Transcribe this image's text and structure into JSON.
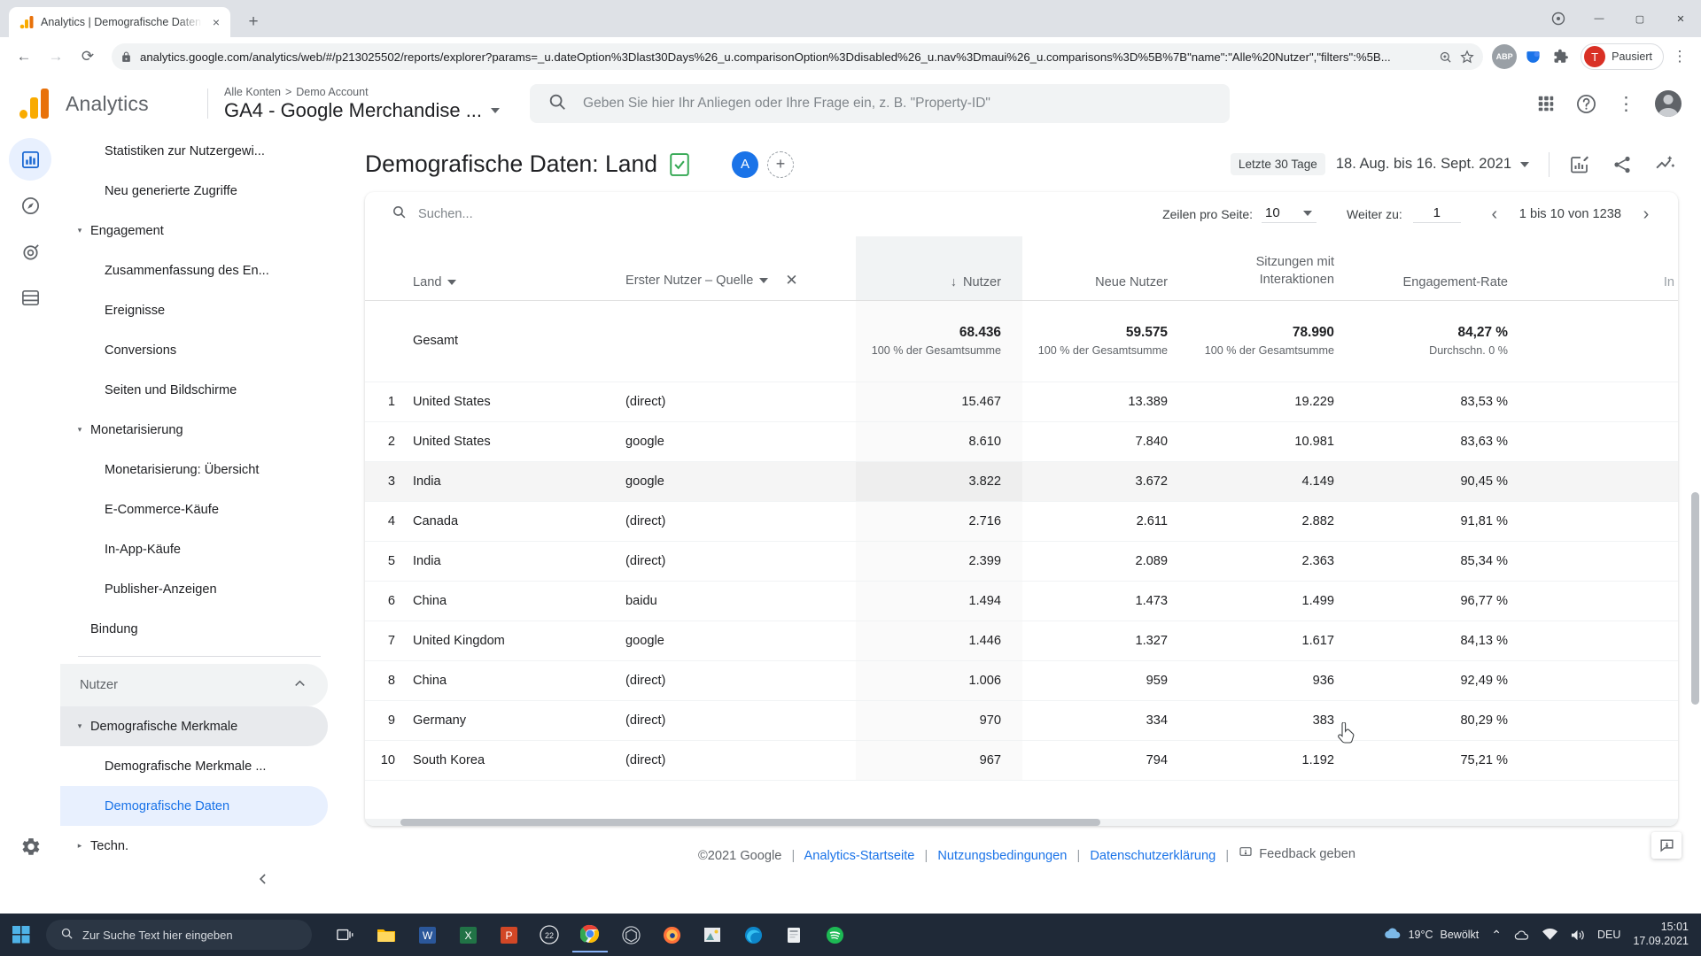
{
  "browser": {
    "tab": {
      "title": "Analytics | Demografische Daten",
      "favicon": "analytics-logo-icon",
      "close": "×"
    },
    "new_tab_label": "+",
    "window_controls": {
      "minimize": "—",
      "maximize": "▢",
      "close": "✕"
    },
    "nav": {
      "back": "←",
      "forward": "→",
      "reload": "⟳"
    },
    "omnibox": {
      "lock": "lock-icon",
      "url": "analytics.google.com/analytics/web/#/p213025502/reports/explorer?params=_u.dateOption%3Dlast30Days%26_u.comparisonOption%3Ddisabled%26_u.nav%3Dmaui%26_u.comparisons%3D%5B%7B\"name\":\"Alle%20Nutzer\",\"filters\":%5B...",
      "zoom_icon": "zoom-search-icon",
      "star_icon": "bookmark-star-icon"
    },
    "extensions": [
      {
        "name": "abp-extension-icon",
        "label": "ABP"
      },
      {
        "name": "pocket-extension-icon",
        "label": "◉"
      },
      {
        "name": "puzzle-extensions-icon",
        "label": "🧩"
      }
    ],
    "profile": {
      "initial": "T",
      "label": "Pausiert"
    },
    "menu_icon": "kebab-menu-icon"
  },
  "ga_header": {
    "wordmark": "Analytics",
    "breadcrumb": [
      "Alle Konten",
      "Demo Account"
    ],
    "breadcrumb_separator": ">",
    "property_name": "GA4 - Google Merchandise ...",
    "search_placeholder": "Geben Sie hier Ihr Anliegen oder Ihre Frage ein, z. B. \"Property-ID\"",
    "search_value": "",
    "icons": {
      "apps": "apps-grid-icon",
      "help": "help-circle-icon",
      "more": "kebab-menu-icon",
      "avatar": "user-avatar"
    }
  },
  "rail": {
    "items": [
      {
        "name": "reports-bar-chart-icon",
        "active": true
      },
      {
        "name": "explore-compass-icon",
        "active": false
      },
      {
        "name": "advertising-target-icon",
        "active": false
      },
      {
        "name": "configure-table-icon",
        "active": false
      }
    ],
    "settings_icon": "gear-icon"
  },
  "sidebar": {
    "items": [
      {
        "label": "Statistiken zur Nutzergewi...",
        "level": "child",
        "state": "normal",
        "twisty": ""
      },
      {
        "label": "Neu generierte Zugriffe",
        "level": "child",
        "state": "normal",
        "twisty": ""
      },
      {
        "label": "Engagement",
        "level": "group",
        "state": "normal",
        "twisty": "▾"
      },
      {
        "label": "Zusammenfassung des En...",
        "level": "child",
        "state": "normal",
        "twisty": ""
      },
      {
        "label": "Ereignisse",
        "level": "child",
        "state": "normal",
        "twisty": ""
      },
      {
        "label": "Conversions",
        "level": "child",
        "state": "normal",
        "twisty": ""
      },
      {
        "label": "Seiten und Bildschirme",
        "level": "child",
        "state": "normal",
        "twisty": ""
      },
      {
        "label": "Monetarisierung",
        "level": "group",
        "state": "normal",
        "twisty": "▾"
      },
      {
        "label": "Monetarisierung: Übersicht",
        "level": "child",
        "state": "normal",
        "twisty": ""
      },
      {
        "label": "E-Commerce-Käufe",
        "level": "child",
        "state": "normal",
        "twisty": ""
      },
      {
        "label": "In-App-Käufe",
        "level": "child",
        "state": "normal",
        "twisty": ""
      },
      {
        "label": "Publisher-Anzeigen",
        "level": "child",
        "state": "normal",
        "twisty": ""
      },
      {
        "label": "Bindung",
        "level": "group-noarrow",
        "state": "normal",
        "twisty": ""
      }
    ],
    "section_header": {
      "label": "Nutzer",
      "collapse_icon": "chevron-up-icon"
    },
    "items2": [
      {
        "label": "Demografische Merkmale",
        "level": "group",
        "state": "selected",
        "twisty": "▾"
      },
      {
        "label": "Demografische Merkmale ...",
        "level": "child",
        "state": "normal",
        "twisty": ""
      },
      {
        "label": "Demografische Daten",
        "level": "child",
        "state": "active",
        "twisty": ""
      },
      {
        "label": "Techn.",
        "level": "group",
        "state": "normal",
        "twisty": "▸"
      }
    ],
    "collapse_sidebar_icon": "chevron-left-icon"
  },
  "main": {
    "page_title": "Demografische Daten: Land",
    "title_badge_icon": "sheets-export-icon",
    "audience_chip": "A",
    "add_comparison": "+",
    "date_preset": "Letzte 30 Tage",
    "date_range": "18. Aug. bis 16. Sept. 2021",
    "date_caret": "▾",
    "header_icons": [
      {
        "name": "insights-edit-icon"
      },
      {
        "name": "share-icon"
      },
      {
        "name": "add-insight-icon"
      }
    ]
  },
  "table_toolbar": {
    "search_icon": "search-icon",
    "search_placeholder": "Suchen...",
    "search_value": "",
    "rows_per_page_label": "Zeilen pro Seite:",
    "rows_per_page_value": "10",
    "rows_per_page_caret": "▾",
    "goto_label": "Weiter zu:",
    "goto_value": "1",
    "prev_icon": "‹",
    "next_icon": "›",
    "range_text": "1 bis 10 von 1238"
  },
  "chart_data": {
    "type": "table",
    "title": "Demografische Daten: Land",
    "columns": [
      {
        "key": "idx",
        "label": "",
        "align": "right"
      },
      {
        "key": "land",
        "label": "Land",
        "align": "left",
        "caret": "▾"
      },
      {
        "key": "quelle",
        "label": "Erster Nutzer – Quelle",
        "align": "left",
        "caret": "▾",
        "removable": true,
        "remove_icon": "✕"
      },
      {
        "key": "nutzer",
        "label": "Nutzer",
        "align": "right",
        "sorted": true,
        "sort_icon": "↓"
      },
      {
        "key": "neue_nutzer",
        "label": "Neue Nutzer",
        "align": "right"
      },
      {
        "key": "sitzungen",
        "label": "Sitzungen mit Interaktionen",
        "align": "right"
      },
      {
        "key": "engagement_rate",
        "label": "Engagement-Rate",
        "align": "right"
      },
      {
        "key": "clipped",
        "label": "In",
        "align": "right"
      }
    ],
    "total_row": {
      "label": "Gesamt",
      "nutzer": "68.436",
      "nutzer_sub": "100 % der Gesamtsumme",
      "neue_nutzer": "59.575",
      "neue_nutzer_sub": "100 % der Gesamtsumme",
      "sitzungen": "78.990",
      "sitzungen_sub": "100 % der Gesamtsumme",
      "engagement_rate": "84,27 %",
      "engagement_rate_sub": "Durchschn. 0 %"
    },
    "rows": [
      {
        "idx": "1",
        "land": "United States",
        "quelle": "(direct)",
        "nutzer": "15.467",
        "neue_nutzer": "13.389",
        "sitzungen": "19.229",
        "engagement_rate": "83,53 %"
      },
      {
        "idx": "2",
        "land": "United States",
        "quelle": "google",
        "nutzer": "8.610",
        "neue_nutzer": "7.840",
        "sitzungen": "10.981",
        "engagement_rate": "83,63 %"
      },
      {
        "idx": "3",
        "land": "India",
        "quelle": "google",
        "nutzer": "3.822",
        "neue_nutzer": "3.672",
        "sitzungen": "4.149",
        "engagement_rate": "90,45 %",
        "hover": true
      },
      {
        "idx": "4",
        "land": "Canada",
        "quelle": "(direct)",
        "nutzer": "2.716",
        "neue_nutzer": "2.611",
        "sitzungen": "2.882",
        "engagement_rate": "91,81 %"
      },
      {
        "idx": "5",
        "land": "India",
        "quelle": "(direct)",
        "nutzer": "2.399",
        "neue_nutzer": "2.089",
        "sitzungen": "2.363",
        "engagement_rate": "85,34 %"
      },
      {
        "idx": "6",
        "land": "China",
        "quelle": "baidu",
        "nutzer": "1.494",
        "neue_nutzer": "1.473",
        "sitzungen": "1.499",
        "engagement_rate": "96,77 %"
      },
      {
        "idx": "7",
        "land": "United Kingdom",
        "quelle": "google",
        "nutzer": "1.446",
        "neue_nutzer": "1.327",
        "sitzungen": "1.617",
        "engagement_rate": "84,13 %"
      },
      {
        "idx": "8",
        "land": "China",
        "quelle": "(direct)",
        "nutzer": "1.006",
        "neue_nutzer": "959",
        "sitzungen": "936",
        "engagement_rate": "92,49 %"
      },
      {
        "idx": "9",
        "land": "Germany",
        "quelle": "(direct)",
        "nutzer": "970",
        "neue_nutzer": "334",
        "sitzungen": "383",
        "engagement_rate": "80,29 %"
      },
      {
        "idx": "10",
        "land": "South Korea",
        "quelle": "(direct)",
        "nutzer": "967",
        "neue_nutzer": "794",
        "sitzungen": "1.192",
        "engagement_rate": "75,21 %"
      }
    ]
  },
  "footer": {
    "copyright": "©2021 Google",
    "links": [
      "Analytics-Startseite",
      "Nutzungsbedingungen",
      "Datenschutzerklärung"
    ],
    "feedback": "Feedback geben",
    "feedback_icon": "feedback-icon",
    "separator": "|"
  },
  "taskbar": {
    "start_icon": "windows-start-icon",
    "search_placeholder": "Zur Suche Text hier eingeben",
    "search_icon": "search-icon",
    "task_view_icon": "task-view-icon",
    "apps": [
      {
        "name": "file-explorer-icon"
      },
      {
        "name": "word-icon",
        "label": "W"
      },
      {
        "name": "excel-icon",
        "label": "X"
      },
      {
        "name": "powerpoint-icon",
        "label": "P"
      },
      {
        "name": "acrobat-icon",
        "label": "22"
      },
      {
        "name": "chrome-icon"
      },
      {
        "name": "unity-icon"
      },
      {
        "name": "firefox-icon"
      },
      {
        "name": "photos-icon"
      },
      {
        "name": "edge-icon"
      },
      {
        "name": "store-icon"
      },
      {
        "name": "spotify-icon"
      }
    ],
    "weather": {
      "temp": "19°C",
      "desc": "Bewölkt",
      "icon": "cloud-icon"
    },
    "tray": {
      "chevron": "⌃",
      "cloud": "cloud-icon",
      "network": "network-icon",
      "volume": "volume-icon",
      "lang": "DEU"
    },
    "clock": {
      "time": "15:01",
      "date": "17.09.2021"
    }
  }
}
